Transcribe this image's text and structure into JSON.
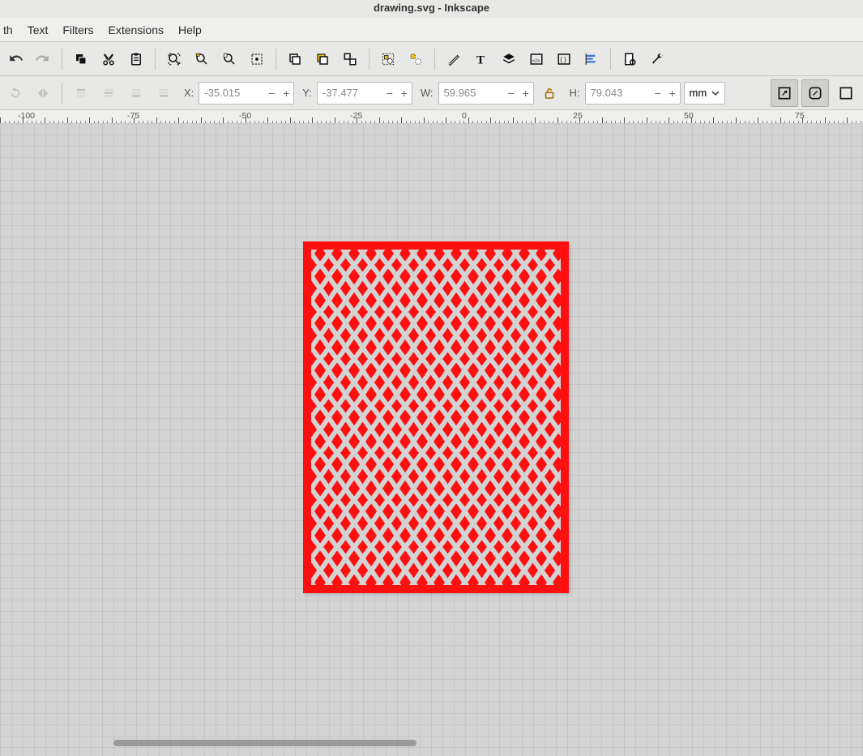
{
  "window": {
    "title": "drawing.svg - Inkscape"
  },
  "menu": {
    "path": "th",
    "text": "Text",
    "filters": "Filters",
    "extensions": "Extensions",
    "help": "Help"
  },
  "coords": {
    "x_label": "X:",
    "x": "-35.015",
    "y_label": "Y:",
    "y": "-37.477",
    "w_label": "W:",
    "w": "59.965",
    "h_label": "H:",
    "h": "79.043",
    "unit": "mm"
  },
  "ruler": {
    "m100": "-100",
    "m75": "-75",
    "m50": "-50",
    "m25": "-25",
    "zero": "0",
    "p25": "25",
    "p50": "50",
    "p75": "75"
  },
  "colors": {
    "page_fill": "#ff1010",
    "pattern_stroke": "#d3d3d3"
  }
}
